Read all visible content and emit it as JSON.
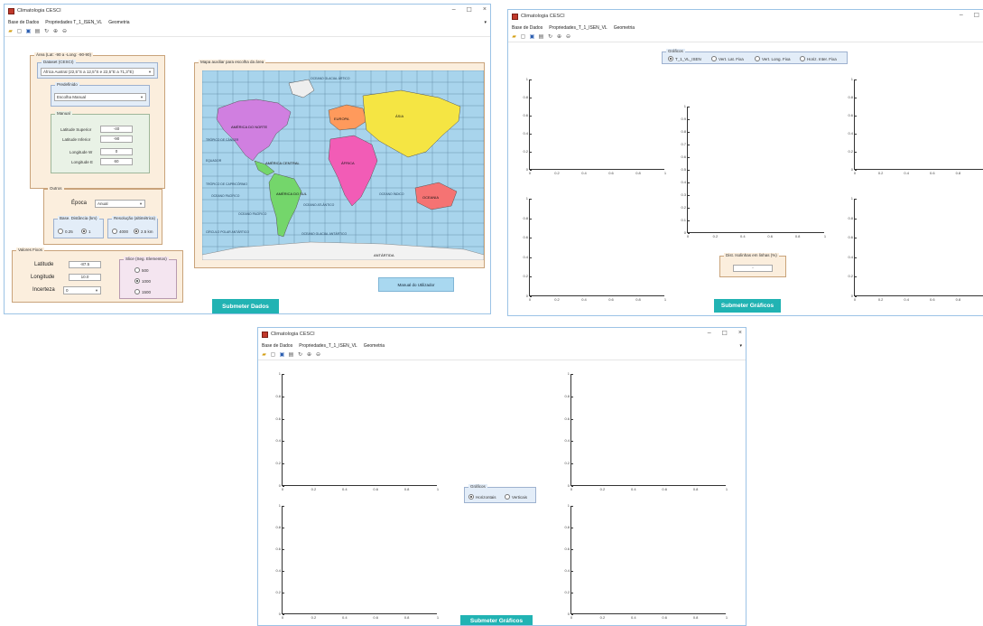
{
  "win1": {
    "title": "Climatologia CESCI",
    "menu": [
      "Base de Dados",
      "Propriedades T_1_ISEN_VL",
      "Geometria"
    ],
    "area_panel_title": "Área (Lat: -90 a -Long: -90-90)",
    "dataset_label": "Dataset (CESCI)",
    "dataset_value": "África Austral (22,5°S a 12,5°S e 22,5°E a 71,3°E)",
    "dataset_group": "Predefinido",
    "dataset_group_value": "Escolha Manual",
    "manual_label": "Manual",
    "lat_sup_label": "Latitude Superior",
    "lat_sup_value": "-40",
    "lat_inf_label": "Latitude Inferior",
    "lat_inf_value": "-90",
    "long_w_label": "Longitude W",
    "long_w_value": "0",
    "long_e_label": "Longitude E",
    "long_e_value": "60",
    "outros_label": "Outros",
    "epoca_label": "Época",
    "epoca_value": "Anual",
    "base_dist_label": "Base. Distância (km)",
    "radio_025": "0.25",
    "radio_1": "1",
    "resolucao_label": "Resolução (altimétrica)",
    "radio_4000": "4000",
    "radio_25km": "2.5 km",
    "fixed_vals_label": "Valores Fixos",
    "latitude_label": "Latitude",
    "latitude_value": "-87.5",
    "longitude_label": "Longitude",
    "longitude_value": "10.0",
    "incerteza_label": "Incerteza",
    "incerteza_value": "0",
    "slice_label": "Slice (Seg. Elementos)",
    "slice_opts": [
      "500",
      "1000",
      "1500"
    ],
    "map_panel_title": "Mapa auxiliar para escolha da área",
    "map_continents": [
      "AMÉRICA DO NORTE",
      "EUROPA",
      "ÁSIA",
      "ÁFRICA",
      "AMÉRICA CENTRAL",
      "AMÉRICA DO SUL",
      "OCEANIA",
      "ANTÁRTIDA"
    ],
    "map_oceans": [
      "OCEANO GLACIAL ÁRTICO",
      "OCEANO PACÍFICO",
      "OCEANO ATLÂNTICO",
      "OCEANO ÍNDICO",
      "OCEANO PACÍFICO",
      "OCEANO GLACIAL ANTÁRTICO"
    ],
    "map_lines": [
      "TRÓPICO DE CÂNCER",
      "EQUADOR",
      "TRÓPICO DE CAPRICÓRNIO",
      "CÍRCULO POLAR ANTÁRTICO"
    ],
    "manual_btn": "Manual do Utilizador",
    "submit_btn": "Submeter Dados"
  },
  "win2": {
    "title": "Climatologia CESCI",
    "menu": [
      "Base de Dados",
      "Propriedades_T_1_ISEN_VL",
      "Geometria"
    ],
    "graficos_label": "Gráficos",
    "graficos_opts": [
      "T_1_VL_ISEN",
      "Vert. Lat. Fixa",
      "Vert. Long. Fixa",
      "Horiz. Inter. Fixa"
    ],
    "thickness_label": "Dist. Isolinhas em linhas (%)",
    "thickness_value": "-",
    "submit_btn": "Submeter Gráficos"
  },
  "win3": {
    "title": "Climatologia CESCI",
    "menu": [
      "Base de Dados",
      "Propriedades_T_1_ISEN_VL",
      "Geometria"
    ],
    "graficos_label": "Gráficos",
    "opt_horizontais": "Horizontais",
    "opt_verticais": "Verticais",
    "submit_btn": "Submeter Gráficos"
  },
  "axis": {
    "y_ticks": [
      "1",
      "0.8",
      "0.6",
      "0.4",
      "0.2",
      "0"
    ],
    "x_ticks": [
      "0",
      "0.2",
      "0.4",
      "0.6",
      "0.8",
      "1"
    ],
    "y_ticks_10": [
      "1",
      "0.9",
      "0.8",
      "0.7",
      "0.6",
      "0.5",
      "0.4",
      "0.3",
      "0.2",
      "0.1",
      "0"
    ]
  },
  "colors": {
    "submit": "#21b3b3",
    "panel": "#fbeedd",
    "accent": "#9cc3e6"
  }
}
